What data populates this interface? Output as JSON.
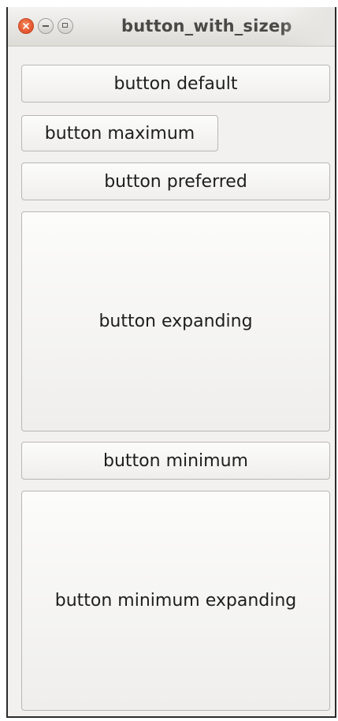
{
  "window": {
    "title": "button_with_sizep"
  },
  "titlebar_icons": [
    "close-icon",
    "minimize-icon",
    "maximize-icon"
  ],
  "buttons": {
    "default": "button default",
    "maximum": "button maximum",
    "preferred": "button preferred",
    "expanding": "button expanding",
    "minimum": "button minimum",
    "minimum_expanding": "button minimum expanding"
  },
  "colors": {
    "close_button": "#e2522a",
    "window_background": "#f2f1f0"
  }
}
